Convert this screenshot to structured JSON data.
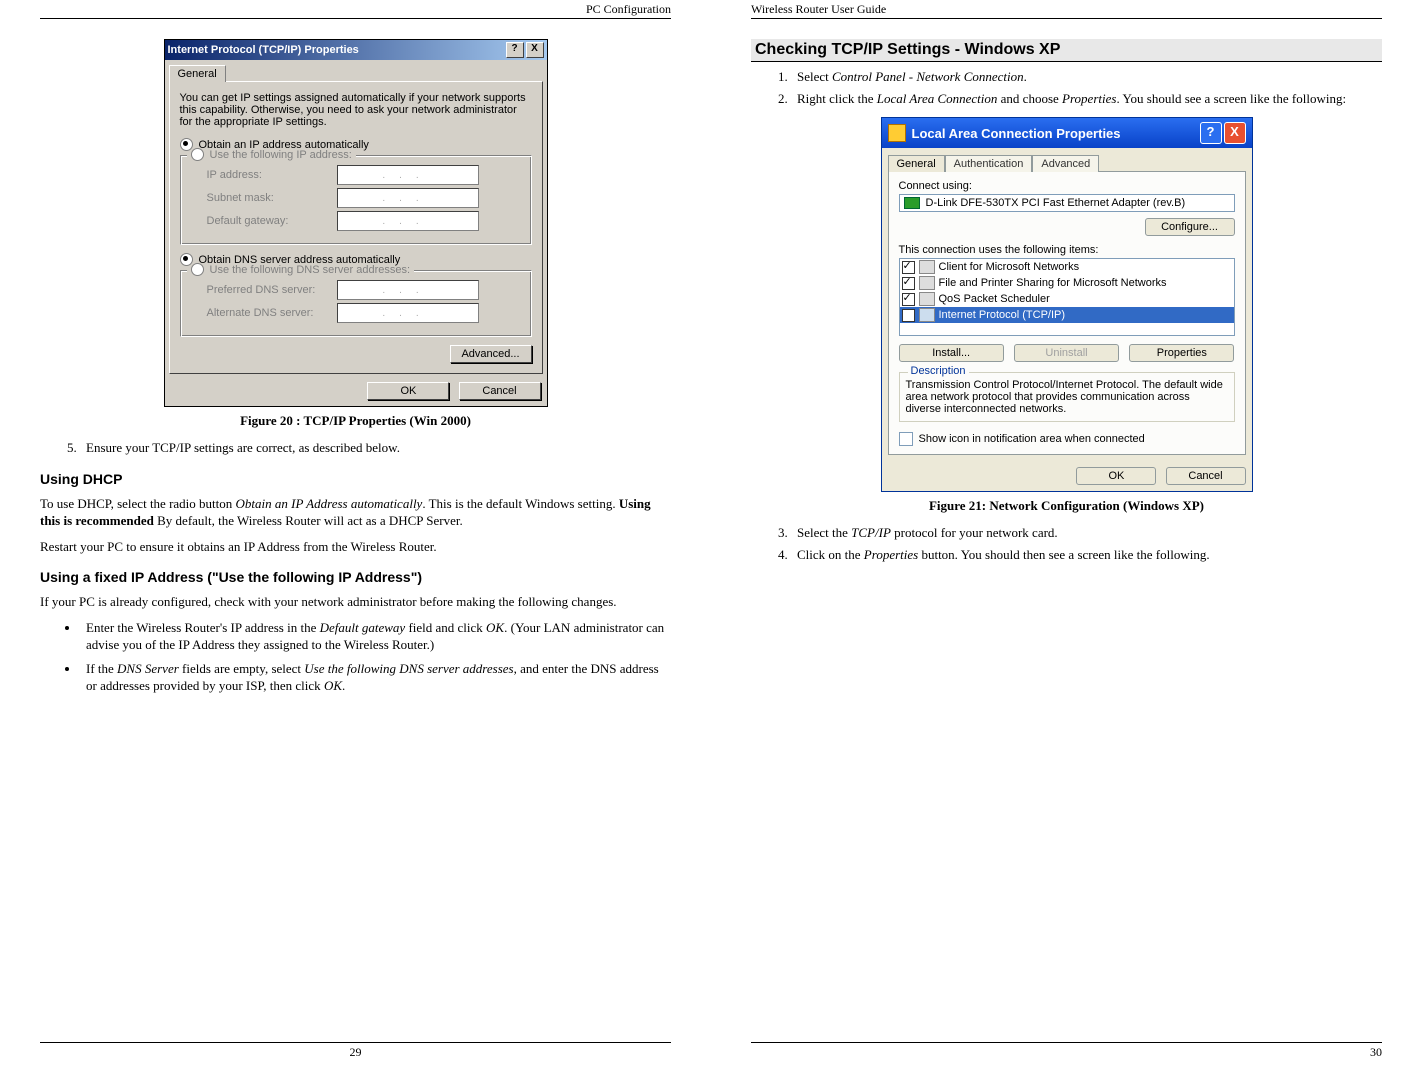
{
  "left": {
    "header": "PC Configuration",
    "page_num": "29",
    "fig20": {
      "title": "Internet Protocol (TCP/IP) Properties",
      "help_btn": "?",
      "close_btn": "X",
      "tab": "General",
      "intro": "You can get IP settings assigned automatically if your network supports this capability. Otherwise, you need to ask your network administrator for the appropriate IP settings.",
      "radio_obtain_ip": "Obtain an IP address automatically",
      "radio_use_ip": "Use the following IP address:",
      "lbl_ip": "IP address:",
      "lbl_subnet": "Subnet mask:",
      "lbl_gateway": "Default gateway:",
      "radio_obtain_dns": "Obtain DNS server address automatically",
      "radio_use_dns": "Use the following DNS server addresses:",
      "lbl_pref_dns": "Preferred DNS server:",
      "lbl_alt_dns": "Alternate DNS server:",
      "btn_advanced": "Advanced...",
      "btn_ok": "OK",
      "btn_cancel": "Cancel"
    },
    "caption20": "Figure 20 : TCP/IP Properties (Win 2000)",
    "step5": "Ensure your TCP/IP settings are correct, as described below.",
    "h_dhcp": "Using DHCP",
    "dhcp_p1a": "To use DHCP, select the radio button ",
    "dhcp_p1b": "Obtain an IP Address automatically",
    "dhcp_p1c": ". This is the default Windows setting. ",
    "dhcp_p1d": "Using this is recommended",
    "dhcp_p1e": " By default, the Wireless Router will act as a DHCP Server.",
    "dhcp_p2": "Restart your PC to ensure it obtains an IP Address from the Wireless Router.",
    "h_fixed": "Using a fixed IP Address (\"Use the following IP Address\")",
    "fixed_intro": "If your PC is already configured, check with your network administrator before making the following changes.",
    "bul1a": "Enter the Wireless Router's IP address in the ",
    "bul1b": "Default gateway",
    "bul1c": " field and click ",
    "bul1d": "OK",
    "bul1e": ". (Your LAN administrator can advise you of the IP Address they assigned to the Wireless Router.)",
    "bul2a": "If the ",
    "bul2b": "DNS Server",
    "bul2c": " fields are empty, select ",
    "bul2d": "Use the following DNS server addresses",
    "bul2e": ", and enter the DNS address or addresses provided by your ISP, then click ",
    "bul2f": "OK",
    "bul2g": "."
  },
  "right": {
    "header": "Wireless Router User Guide",
    "page_num": "30",
    "h_xp": "Checking TCP/IP Settings - Windows XP",
    "s1a": "Select ",
    "s1b": "Control Panel - Network Connection",
    "s1c": ".",
    "s2a": "Right click the ",
    "s2b": "Local Area Connection",
    "s2c": " and choose ",
    "s2d": "Properties",
    "s2e": ". You should see a screen like the following:",
    "fig21": {
      "title": "Local Area Connection Properties",
      "help_btn": "?",
      "close_btn": "X",
      "tab_general": "General",
      "tab_auth": "Authentication",
      "tab_adv": "Advanced",
      "connect_using": "Connect using:",
      "adapter": "D-Link DFE-530TX PCI Fast Ethernet Adapter (rev.B)",
      "btn_configure": "Configure...",
      "uses_items": "This connection uses the following items:",
      "item1": "Client for Microsoft Networks",
      "item2": "File and Printer Sharing for Microsoft Networks",
      "item3": "QoS Packet Scheduler",
      "item4": "Internet Protocol (TCP/IP)",
      "btn_install": "Install...",
      "btn_uninstall": "Uninstall",
      "btn_properties": "Properties",
      "desc_legend": "Description",
      "desc_text": "Transmission Control Protocol/Internet Protocol. The default wide area network protocol that provides communication across diverse interconnected networks.",
      "chk_showicon": "Show icon in notification area when connected",
      "btn_ok": "OK",
      "btn_cancel": "Cancel"
    },
    "caption21": "Figure 21: Network Configuration (Windows  XP)",
    "s3a": "Select the ",
    "s3b": "TCP/IP",
    "s3c": " protocol for your network card.",
    "s4a": "Click on the ",
    "s4b": "Properties",
    "s4c": " button. You should then see a screen like the following."
  }
}
